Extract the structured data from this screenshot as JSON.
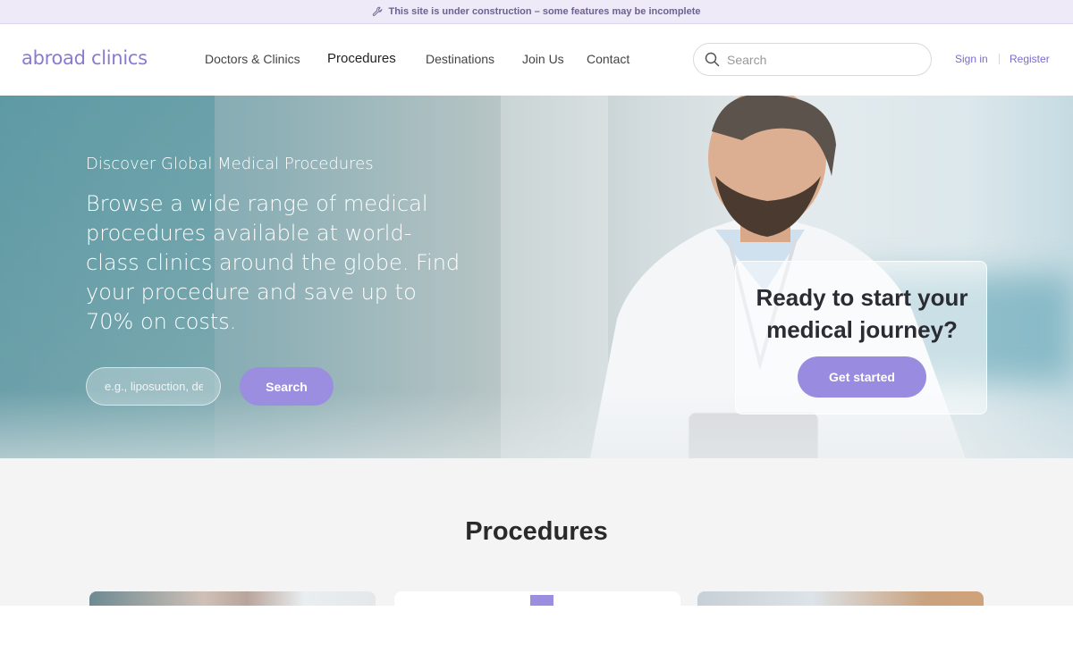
{
  "banner": {
    "icon": "wrench-icon",
    "text": "This site is under construction – some features may be incomplete"
  },
  "header": {
    "logo": "abroad clinics",
    "nav": [
      {
        "label": "Doctors & Clinics",
        "active": false
      },
      {
        "label": "Procedures",
        "active": true
      },
      {
        "label": "Destinations",
        "active": false
      },
      {
        "label": "Join Us",
        "active": false
      },
      {
        "label": "Contact",
        "active": false
      }
    ],
    "search": {
      "placeholder": "Search",
      "icon": "search-icon"
    },
    "sign_in": "Sign in",
    "register": "Register"
  },
  "hero": {
    "tagline": "Discover Global Medical Procedures",
    "text": "Browse a wide range of medical procedures available at world-class clinics around the globe. Find your procedure and save up to 70% on costs.",
    "search_placeholder": "e.g., liposuction, de",
    "search_button": "Search"
  },
  "cta": {
    "title": "Ready to start your medical journey?",
    "button": "Get started"
  },
  "procedures": {
    "title": "Procedures"
  },
  "colors": {
    "accent": "#9b8ee0",
    "banner_bg": "#efeaf8",
    "link": "#7a6ccc"
  }
}
